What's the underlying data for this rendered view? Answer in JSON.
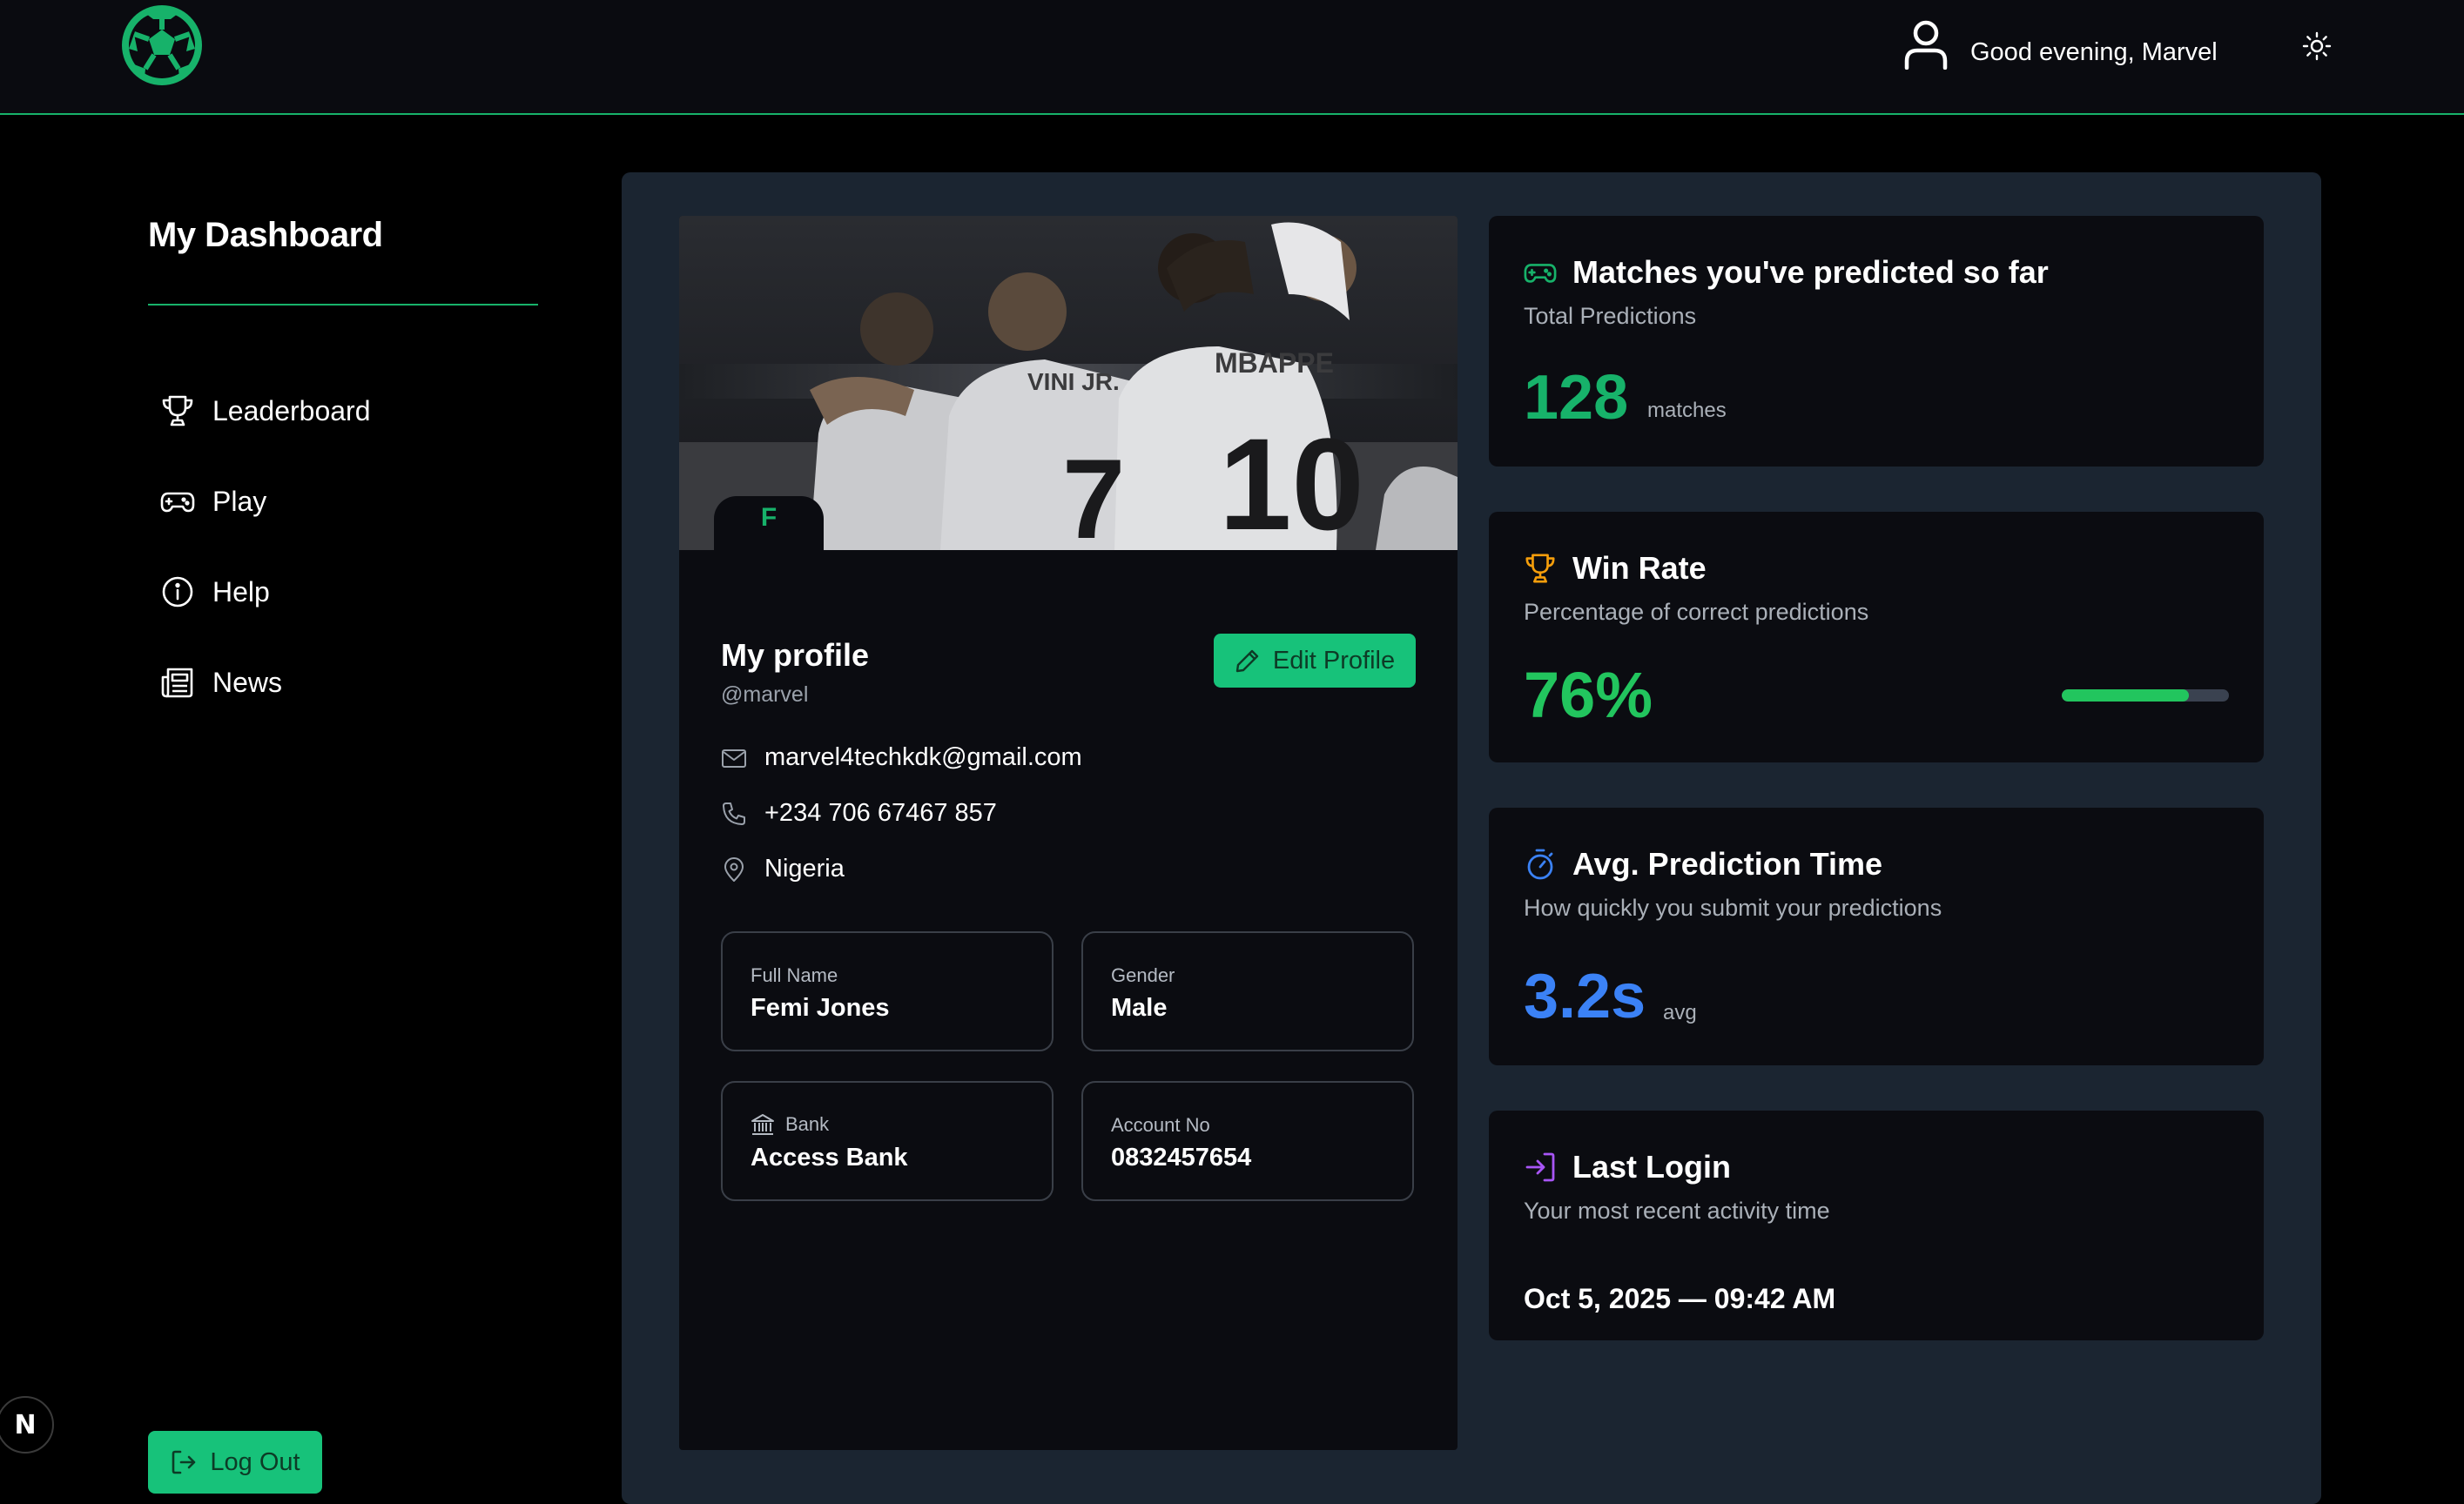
{
  "header": {
    "greeting": "Good evening, Marvel"
  },
  "sidebar": {
    "title": "My Dashboard",
    "items": [
      {
        "label": "Leaderboard",
        "icon": "trophy-icon"
      },
      {
        "label": "Play",
        "icon": "gamepad-icon"
      },
      {
        "label": "Help",
        "icon": "info-icon"
      },
      {
        "label": "News",
        "icon": "newspaper-icon"
      }
    ],
    "logout_label": "Log Out",
    "framework_badge": "N"
  },
  "profile": {
    "avatar_initial": "F",
    "title": "My profile",
    "handle": "@marvel",
    "edit_label": "Edit Profile",
    "email": "marvel4techkdk@gmail.com",
    "phone": "+234 706 67467 857",
    "location": "Nigeria",
    "fields": {
      "full_name": {
        "label": "Full Name",
        "value": "Femi Jones"
      },
      "gender": {
        "label": "Gender",
        "value": "Male"
      },
      "bank": {
        "label": "Bank",
        "value": "Access Bank"
      },
      "account": {
        "label": "Account No",
        "value": "0832457654"
      }
    }
  },
  "stats": {
    "matches": {
      "title": "Matches you've predicted so far",
      "subtitle": "Total Predictions",
      "value": "128",
      "unit": "matches"
    },
    "win_rate": {
      "title": "Win Rate",
      "subtitle": "Percentage of correct predictions",
      "value": "76%",
      "progress": 0.76
    },
    "avg_time": {
      "title": "Avg. Prediction Time",
      "subtitle": "How quickly you submit your predictions",
      "value": "3.2s",
      "unit": "avg"
    },
    "last_login": {
      "title": "Last Login",
      "subtitle": "Your most recent activity time",
      "value": "Oct 5, 2025 — 09:42 AM"
    }
  },
  "colors": {
    "accent": "#17c27a",
    "win_rate": "#22c55e",
    "avg_time": "#3b82f6",
    "trophy": "#f59e0b",
    "login": "#a855f7",
    "panel": "#1b2531",
    "card": "#0b0c11"
  }
}
